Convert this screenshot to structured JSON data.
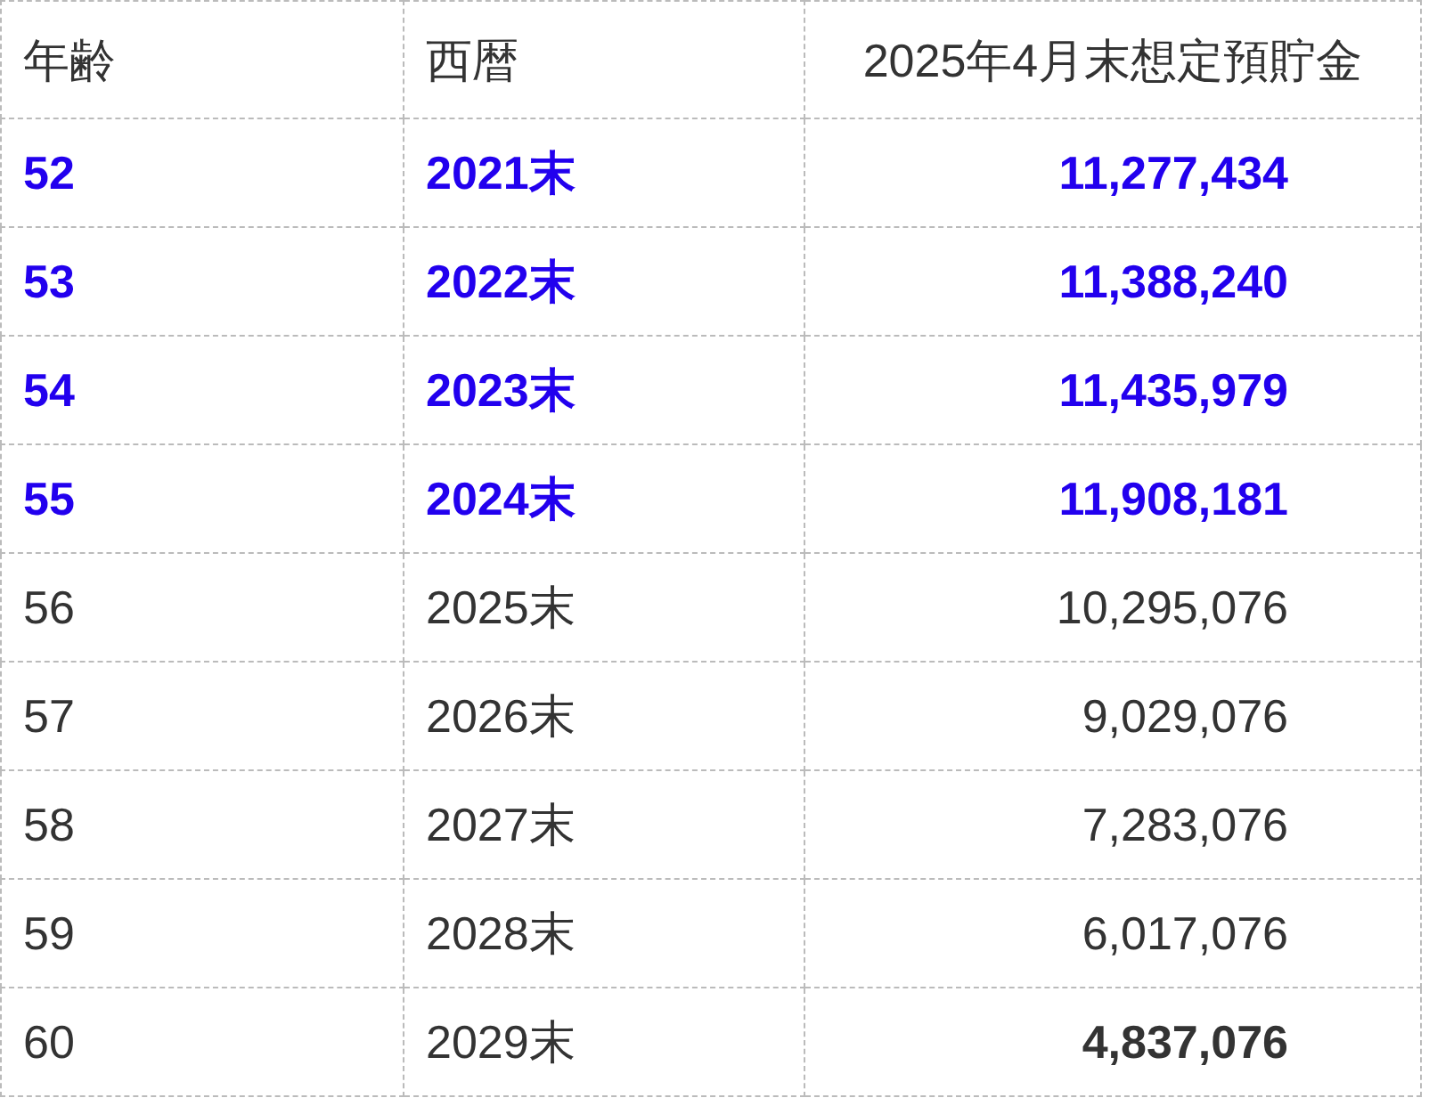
{
  "table": {
    "columns": [
      "年齢",
      "西暦",
      "2025年4月末想定預貯金"
    ],
    "rows": [
      {
        "age": "52",
        "year": "2021末",
        "amount": "11,277,434",
        "highlighted": true,
        "amount_bold": true
      },
      {
        "age": "53",
        "year": "2022末",
        "amount": "11,388,240",
        "highlighted": true,
        "amount_bold": true
      },
      {
        "age": "54",
        "year": "2023末",
        "amount": "11,435,979",
        "highlighted": true,
        "amount_bold": true
      },
      {
        "age": "55",
        "year": "2024末",
        "amount": "11,908,181",
        "highlighted": true,
        "amount_bold": true
      },
      {
        "age": "56",
        "year": "2025末",
        "amount": "10,295,076",
        "highlighted": false,
        "amount_bold": false
      },
      {
        "age": "57",
        "year": "2026末",
        "amount": "9,029,076",
        "highlighted": false,
        "amount_bold": false
      },
      {
        "age": "58",
        "year": "2027末",
        "amount": "7,283,076",
        "highlighted": false,
        "amount_bold": false
      },
      {
        "age": "59",
        "year": "2028末",
        "amount": "6,017,076",
        "highlighted": false,
        "amount_bold": false
      },
      {
        "age": "60",
        "year": "2029末",
        "amount": "4,837,076",
        "highlighted": false,
        "amount_bold": true
      }
    ]
  }
}
